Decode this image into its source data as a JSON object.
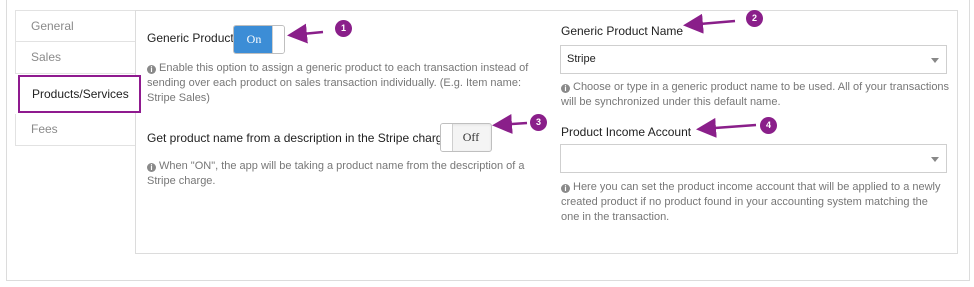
{
  "tabs": [
    {
      "label": "General"
    },
    {
      "label": "Sales"
    },
    {
      "label": "Products/Services"
    },
    {
      "label": "Fees"
    }
  ],
  "generic_product": {
    "label": "Generic Product",
    "toggle_value": "On",
    "help": "Enable this option to assign a generic product to each transaction instead of sending over each product on sales transaction individually. (E.g. Item name: Stripe Sales)"
  },
  "description_name": {
    "label": "Get product name from a description in the Stripe charge",
    "toggle_value": "Off",
    "help": "When \"ON\", the app will be taking a product name from the description of a Stripe charge."
  },
  "generic_product_name": {
    "label": "Generic Product Name",
    "value": "Stripe",
    "help": "Choose or type in a generic product name to be used. All of your transactions will be synchronized under this default name."
  },
  "income_account": {
    "label": "Product Income Account",
    "value": "",
    "help": "Here you can set the product income account that will be applied to a newly created product if no product found in your accounting system matching the one in the transaction."
  },
  "annotations": [
    "1",
    "2",
    "3",
    "4"
  ],
  "colors": {
    "accent": "#8a1f8a",
    "toggle_on": "#3c8dd6"
  },
  "icons": {
    "info": "info-circle-icon",
    "dropdown": "chevron-down-icon"
  }
}
